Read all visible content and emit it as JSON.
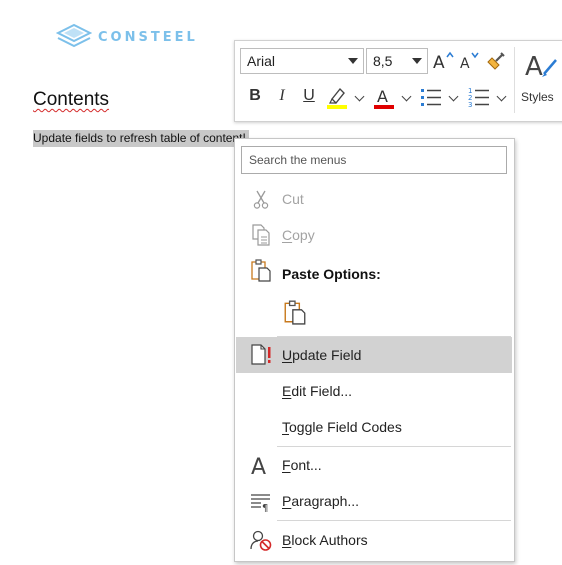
{
  "logo": {
    "text": "CONSTEEL"
  },
  "document": {
    "heading": "Contents",
    "field_text": "Update fields to refresh table of content!"
  },
  "mini_toolbar": {
    "font_name": "Arial",
    "font_size": "8,5",
    "styles_label": "Styles",
    "bold": "B",
    "italic": "I",
    "underline": "U",
    "highlight_color": "#ffff00",
    "font_color": "#e00000"
  },
  "context_menu": {
    "search_placeholder": "Search the menus",
    "cut": {
      "pre": "",
      "key": "",
      "post": "Cut",
      "enabled": false
    },
    "copy": {
      "pre": "",
      "key": "C",
      "post": "opy",
      "enabled": false
    },
    "paste_options_title": "Paste Options:",
    "update_field": {
      "pre": "",
      "key": "U",
      "post": "pdate Field",
      "highlighted": true
    },
    "edit_field": {
      "pre": "",
      "key": "E",
      "post": "dit Field..."
    },
    "toggle_field_codes": {
      "pre": "",
      "key": "T",
      "post": "oggle Field Codes"
    },
    "font": {
      "pre": "",
      "key": "F",
      "post": "ont..."
    },
    "paragraph": {
      "pre": "",
      "key": "P",
      "post": "aragraph..."
    },
    "block_authors": {
      "pre": "",
      "key": "B",
      "post": "lock Authors"
    },
    "accent_color": "#c8791c",
    "alert_color": "#d42a2a"
  }
}
